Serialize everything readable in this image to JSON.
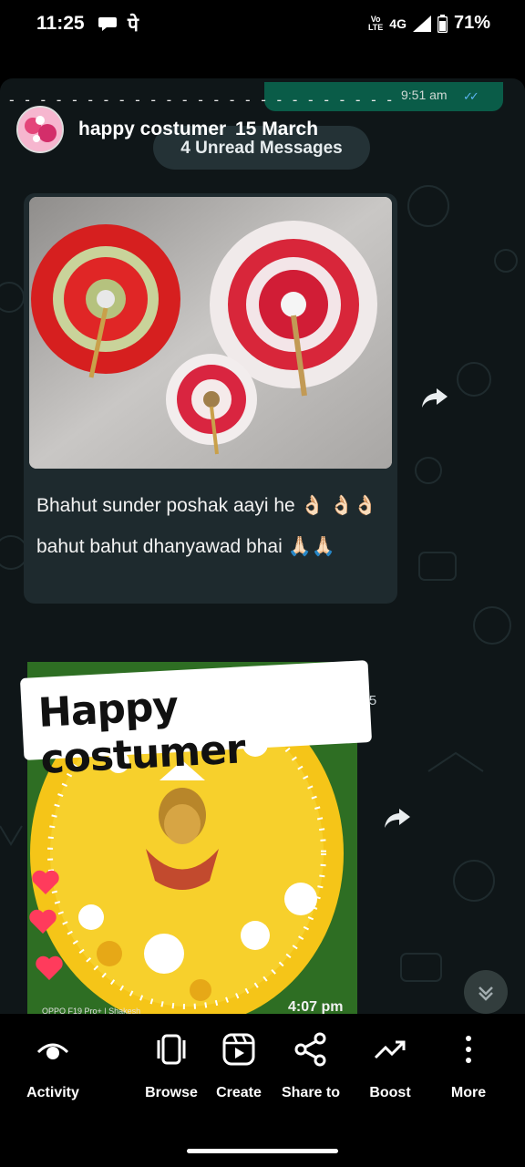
{
  "status_bar": {
    "time": "11:25",
    "extra": "पे",
    "volte_top": "Vo",
    "volte_bottom": "LTE",
    "network": "4G",
    "battery": "71%"
  },
  "chat": {
    "previous_time": "9:51 am",
    "sender": "happy costumer",
    "date": "15 March",
    "unread": "4 Unread Messages",
    "caption": "Bhahut sunder poshak aayi he 👌🏻 👌🏻👌🏻 bahut bahut dhanyawad bhai 🙏🏻🙏🏻",
    "message_time": "4:05 pm"
  },
  "sticker": {
    "text": "Happy costumer"
  },
  "photo2": {
    "time": "4:07 pm",
    "watermark": "OPPO F19 Pro+ | Shakesh"
  },
  "nav": [
    {
      "label": "Activity",
      "icon": "eye-icon"
    },
    {
      "label": "Browse",
      "icon": "carousel-icon"
    },
    {
      "label": "Create",
      "icon": "reel-icon"
    },
    {
      "label": "Share to",
      "icon": "share-icon"
    },
    {
      "label": "Boost",
      "icon": "trending-up-icon"
    },
    {
      "label": "More",
      "icon": "more-vertical-icon"
    }
  ],
  "colors": {
    "chat_bg": "#0f1618",
    "bubble": "#1e2a2e",
    "sent_bubble": "#0a5c48",
    "heart": "#ff3b5c"
  }
}
